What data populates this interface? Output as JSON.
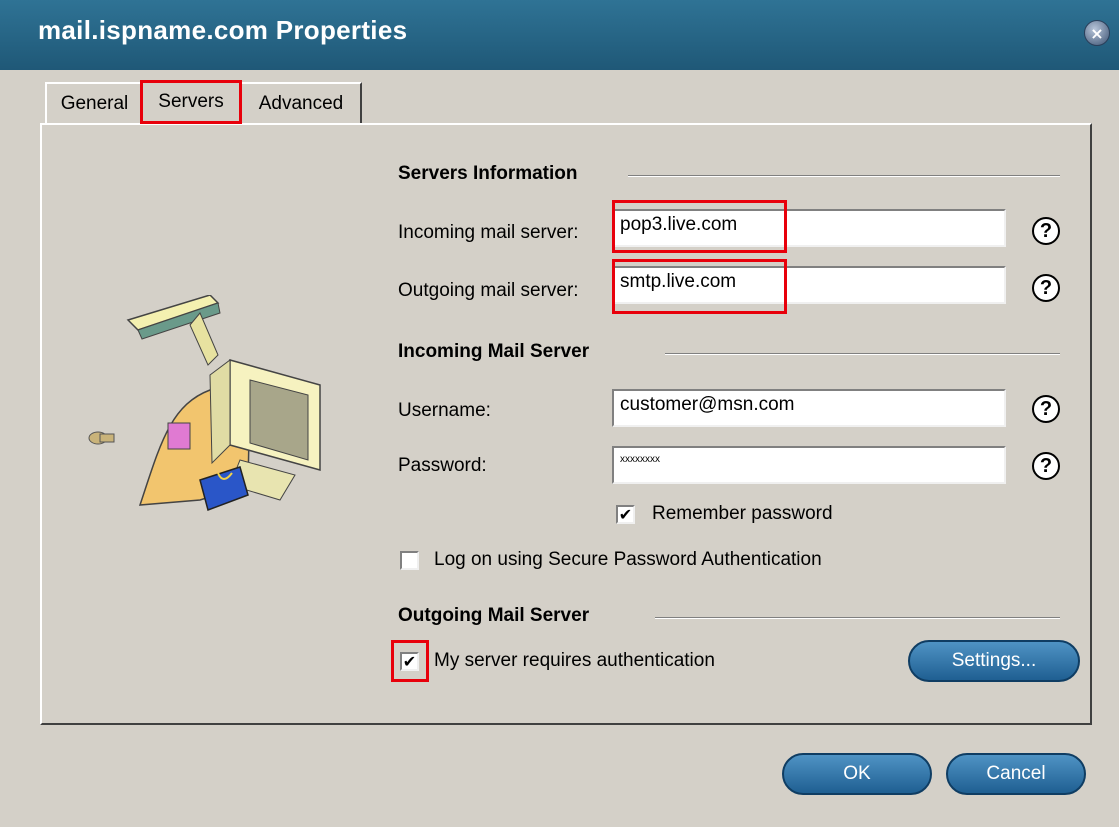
{
  "window": {
    "title": "mail.ispname.com Properties"
  },
  "tabs": [
    {
      "label": "General"
    },
    {
      "label": "Servers"
    },
    {
      "label": "Advanced"
    }
  ],
  "servers_info": {
    "title": "Servers Information",
    "incoming_label": "Incoming mail server:",
    "incoming_value": "pop3.live.com",
    "outgoing_label": "Outgoing mail server:",
    "outgoing_value": "smtp.live.com"
  },
  "incoming_mail": {
    "title": "Incoming Mail Server",
    "username_label": "Username:",
    "username_value": "customer@msn.com",
    "password_label": "Password:",
    "password_value": "xxxxxxxx",
    "remember_label": "Remember password",
    "remember_checked": true,
    "spa_label": "Log on using Secure Password Authentication",
    "spa_checked": false
  },
  "outgoing_mail": {
    "title": "Outgoing Mail Server",
    "auth_label": "My server requires authentication",
    "auth_checked": true,
    "settings_label": "Settings..."
  },
  "buttons": {
    "ok": "OK",
    "cancel": "Cancel"
  },
  "icons": {
    "close": "close-icon",
    "help": "help-icon",
    "illustration": "mail-server-illustration"
  },
  "colors": {
    "title_bar": "#2a6888",
    "highlight": "#e8000b",
    "button": "#2a6fa6"
  }
}
